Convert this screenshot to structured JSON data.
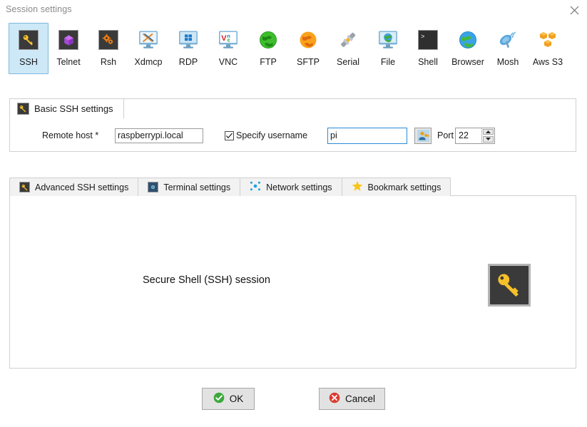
{
  "window": {
    "title": "Session settings",
    "close_label": "×"
  },
  "protocols": {
    "selected": "SSH",
    "items": [
      {
        "label": "SSH",
        "icon": "ssh-key-icon"
      },
      {
        "label": "Telnet",
        "icon": "telnet-cube-icon"
      },
      {
        "label": "Rsh",
        "icon": "rsh-gears-icon"
      },
      {
        "label": "Xdmcp",
        "icon": "xdmcp-monitor-icon"
      },
      {
        "label": "RDP",
        "icon": "rdp-windows-monitor-icon"
      },
      {
        "label": "VNC",
        "icon": "vnc-monitor-icon"
      },
      {
        "label": "FTP",
        "icon": "ftp-green-globe-icon"
      },
      {
        "label": "SFTP",
        "icon": "sftp-orange-globe-icon"
      },
      {
        "label": "Serial",
        "icon": "serial-plug-icon"
      },
      {
        "label": "File",
        "icon": "file-monitor-globe-icon"
      },
      {
        "label": "Shell",
        "icon": "shell-terminal-icon"
      },
      {
        "label": "Browser",
        "icon": "browser-globe-icon"
      },
      {
        "label": "Mosh",
        "icon": "mosh-satellite-icon"
      },
      {
        "label": "Aws S3",
        "icon": "aws-s3-cubes-icon"
      }
    ]
  },
  "basic_settings": {
    "group_title": "Basic SSH settings",
    "group_icon": "ssh-key-icon",
    "remote_host_label": "Remote host *",
    "remote_host_value": "raspberrypi.local",
    "specify_username_label": "Specify username",
    "specify_username_checked": true,
    "username_value": "pi",
    "username_button_icon": "user-key-icon",
    "port_label": "Port",
    "port_value": "22"
  },
  "tabs": {
    "active": "",
    "items": [
      {
        "label": "Advanced SSH settings",
        "icon": "ssh-key-icon"
      },
      {
        "label": "Terminal settings",
        "icon": "terminal-settings-icon"
      },
      {
        "label": "Network settings",
        "icon": "network-dots-icon"
      },
      {
        "label": "Bookmark settings",
        "icon": "star-icon"
      }
    ]
  },
  "panel": {
    "caption": "Secure Shell (SSH) session",
    "big_icon": "ssh-key-icon"
  },
  "footer": {
    "ok_label": "OK",
    "cancel_label": "Cancel"
  },
  "colors": {
    "selection_fill": "#cde8f7",
    "selection_border": "#7cb9dd",
    "focus_border": "#2a8bd8",
    "key_yellow": "#f5c02a",
    "ok_green": "#3aa93a",
    "cancel_red": "#dd3b30",
    "star_yellow": "#f7c61b",
    "tile_dark": "#3a3a3a"
  }
}
